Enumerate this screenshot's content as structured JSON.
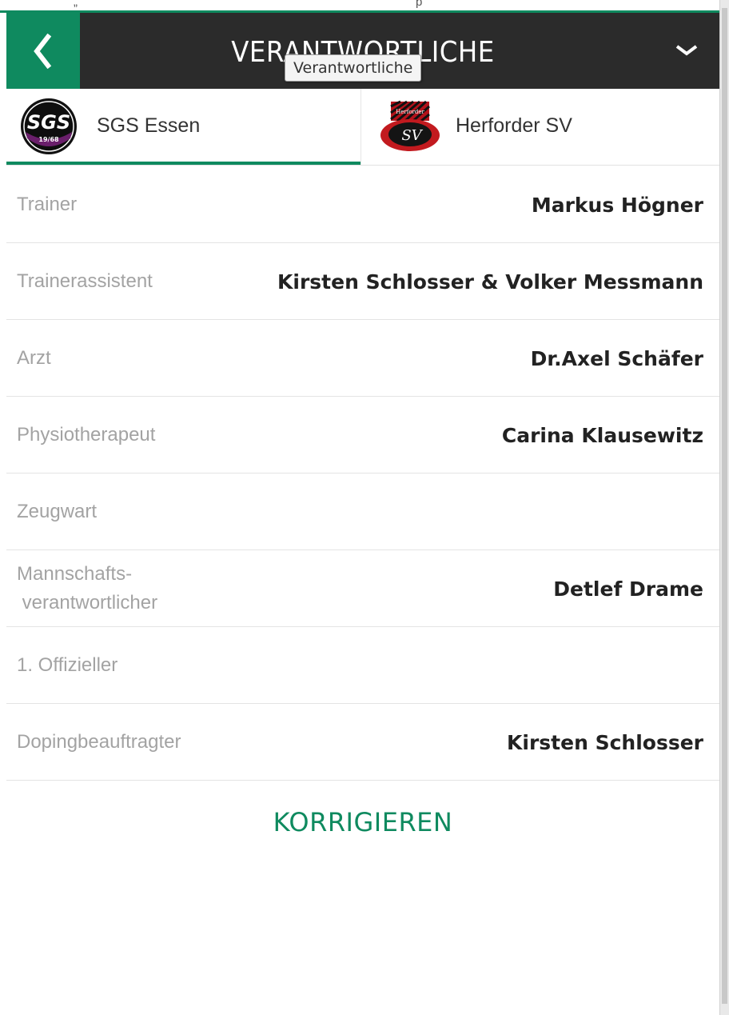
{
  "top_strip": {
    "left_text": "„",
    "right_text": "p"
  },
  "header": {
    "back_icon": "chevron-left-icon",
    "title": "VERANTWORTLICHE",
    "menu_icon": "chevron-down-icon",
    "tooltip": "Verantwortliche",
    "colors": {
      "accent": "#0f8a5f",
      "bar": "#2b2b2b"
    }
  },
  "tabs": [
    {
      "label": "SGS Essen",
      "logo": "sgs-essen-logo",
      "logo_text": "SGS",
      "logo_subtext": "19/68",
      "active": true
    },
    {
      "label": "Herforder SV",
      "logo": "herforder-sv-logo",
      "logo_text": "SV",
      "logo_subtext": "Herforder",
      "active": false
    }
  ],
  "rows": [
    {
      "label": "Trainer",
      "value": "Markus Högner"
    },
    {
      "label": "Trainerassistent",
      "value": "Kirsten Schlosser & Volker Messmann"
    },
    {
      "label": "Arzt",
      "value": "Dr.Axel Schäfer"
    },
    {
      "label": "Physiotherapeut",
      "value": "Carina Klausewitz"
    },
    {
      "label": "Zeugwart",
      "value": ""
    },
    {
      "label": "Mannschafts- verantwortlicher",
      "value": "Detlef Drame"
    },
    {
      "label": "1. Offizieller",
      "value": ""
    },
    {
      "label": "Dopingbeauftragter",
      "value": "Kirsten Schlosser"
    }
  ],
  "actions": {
    "correct_label": "KORRIGIEREN"
  }
}
